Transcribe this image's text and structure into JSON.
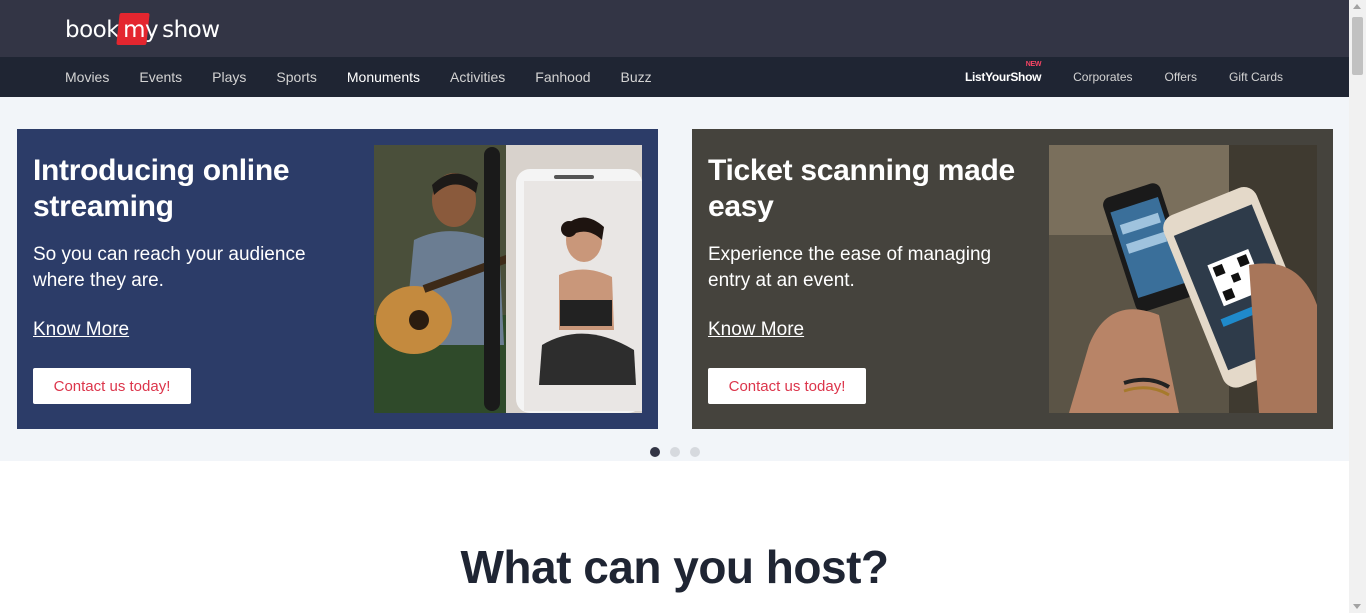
{
  "brand": {
    "logo_left": "book",
    "logo_mid": "my",
    "logo_right": "show"
  },
  "nav": {
    "left": [
      "Movies",
      "Events",
      "Plays",
      "Sports",
      "Monuments",
      "Activities",
      "Fanhood",
      "Buzz"
    ],
    "active": "Monuments",
    "right": {
      "list_your_show": "ListYourShow",
      "new_badge": "NEW",
      "corporates": "Corporates",
      "offers": "Offers",
      "gift_cards": "Gift Cards"
    }
  },
  "slides": [
    {
      "title": "Introducing online streaming",
      "description": "So you can reach your audience where they are.",
      "link": "Know More",
      "cta": "Contact us today!",
      "background": "#2c3c68"
    },
    {
      "title": "Ticket scanning made easy",
      "description": "Experience the ease of managing entry at an event.",
      "link": "Know More",
      "cta": "Contact us today!",
      "background": "#45433d"
    }
  ],
  "carousel": {
    "total": 3,
    "active_index": 0
  },
  "section": {
    "title": "What can you host?"
  },
  "colors": {
    "header": "#333545",
    "nav": "#1f2533",
    "accent": "#dc354b",
    "logo_red": "#e4262f"
  }
}
